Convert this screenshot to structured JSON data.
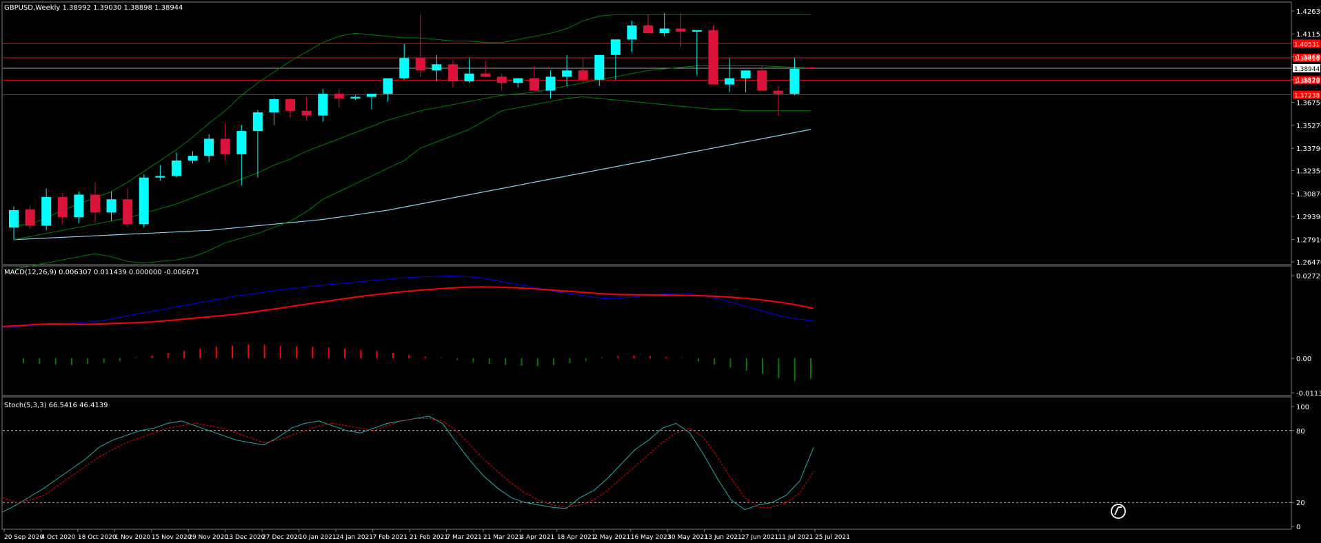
{
  "chart_data": {
    "type": "candlestick",
    "x_labels": [
      "20 Sep 2020",
      "4 Oct 2020",
      "18 Oct 2020",
      "1 Nov 2020",
      "15 Nov 2020",
      "29 Nov 2020",
      "13 Dec 2020",
      "27 Dec 2020",
      "10 Jan 2021",
      "24 Jan 2021",
      "7 Feb 2021",
      "21 Feb 2021",
      "7 Mar 2021",
      "21 Mar 2021",
      "4 Apr 2021",
      "18 Apr 2021",
      "2 May 2021",
      "16 May 2021",
      "30 May 2021",
      "13 Jun 2021",
      "27 Jun 2021",
      "11 Jul 2021",
      "25 Jul 2021"
    ],
    "colors": {
      "background": "#000000",
      "grid": "#808080",
      "bull": "#00FFFF",
      "bear": "#DC143C",
      "text": "#FFFFFF",
      "hline": "#FF0000",
      "bollinger": "#008000",
      "ma": "#87CEEB",
      "macd_line": "#0000FF",
      "macd_signal": "#FF0000",
      "hist_up": "#FF0000",
      "hist_down": "#008000",
      "stoch_k": "#20B2AA",
      "stoch_d": "#FF0000",
      "price_tag": "#FFFFFF"
    },
    "price_panel": {
      "title": "GBPUSD,Weekly  1.38992 1.39030 1.38898 1.38944",
      "y_ticks": [
        "1.42630",
        "1.41155",
        "1.39680",
        "1.38205",
        "1.36750",
        "1.35270",
        "1.33790",
        "1.32350",
        "1.30870",
        "1.29390",
        "1.27910",
        "1.26470"
      ],
      "y_tick_values": [
        1.4263,
        1.41155,
        1.3968,
        1.38205,
        1.3675,
        1.3527,
        1.3379,
        1.3235,
        1.3087,
        1.2939,
        1.2791,
        1.2647
      ],
      "ylim": [
        1.2647,
        1.4263
      ],
      "current_price": "1.38944",
      "current_value": 1.38944,
      "hlines": [
        {
          "label": "1.40531",
          "value": 1.40531
        },
        {
          "label": "1.39616",
          "value": 1.39616
        },
        {
          "label": "1.38178",
          "value": 1.38178
        },
        {
          "label": "1.37238",
          "value": 1.37238
        }
      ],
      "candles": [
        [
          1.2868,
          1.3005,
          1.279,
          1.298
        ],
        [
          1.2985,
          1.301,
          1.286,
          1.288
        ],
        [
          1.288,
          1.312,
          1.285,
          1.3065
        ],
        [
          1.3065,
          1.309,
          1.289,
          1.2935
        ],
        [
          1.2935,
          1.31,
          1.2895,
          1.308
        ],
        [
          1.308,
          1.316,
          1.29,
          1.2965
        ],
        [
          1.2965,
          1.31,
          1.291,
          1.305
        ],
        [
          1.305,
          1.312,
          1.287,
          1.289
        ],
        [
          1.289,
          1.321,
          1.287,
          1.319
        ],
        [
          1.319,
          1.327,
          1.317,
          1.32
        ],
        [
          1.32,
          1.335,
          1.319,
          1.33
        ],
        [
          1.33,
          1.336,
          1.328,
          1.333
        ],
        [
          1.333,
          1.347,
          1.329,
          1.344
        ],
        [
          1.344,
          1.354,
          1.33,
          1.334
        ],
        [
          1.334,
          1.353,
          1.314,
          1.349
        ],
        [
          1.349,
          1.3625,
          1.319,
          1.361
        ],
        [
          1.361,
          1.37,
          1.353,
          1.3695
        ],
        [
          1.3695,
          1.37,
          1.357,
          1.362
        ],
        [
          1.362,
          1.371,
          1.356,
          1.359
        ],
        [
          1.359,
          1.376,
          1.355,
          1.373
        ],
        [
          1.373,
          1.376,
          1.364,
          1.37
        ],
        [
          1.37,
          1.372,
          1.369,
          1.371
        ],
        [
          1.371,
          1.373,
          1.363,
          1.373
        ],
        [
          1.373,
          1.378,
          1.368,
          1.383
        ],
        [
          1.383,
          1.405,
          1.382,
          1.396
        ],
        [
          1.396,
          1.424,
          1.384,
          1.388
        ],
        [
          1.388,
          1.398,
          1.381,
          1.392
        ],
        [
          1.392,
          1.395,
          1.377,
          1.381
        ],
        [
          1.381,
          1.396,
          1.38,
          1.386
        ],
        [
          1.386,
          1.394,
          1.384,
          1.384
        ],
        [
          1.384,
          1.386,
          1.375,
          1.38
        ],
        [
          1.38,
          1.381,
          1.377,
          1.383
        ],
        [
          1.383,
          1.391,
          1.379,
          1.375
        ],
        [
          1.375,
          1.388,
          1.37,
          1.384
        ],
        [
          1.384,
          1.398,
          1.378,
          1.388
        ],
        [
          1.388,
          1.396,
          1.38,
          1.382
        ],
        [
          1.382,
          1.396,
          1.378,
          1.398
        ],
        [
          1.398,
          1.408,
          1.382,
          1.408
        ],
        [
          1.408,
          1.42,
          1.4,
          1.417
        ],
        [
          1.417,
          1.424,
          1.414,
          1.412
        ],
        [
          1.412,
          1.425,
          1.41,
          1.415
        ],
        [
          1.415,
          1.425,
          1.403,
          1.413
        ],
        [
          1.413,
          1.414,
          1.385,
          1.414
        ],
        [
          1.414,
          1.417,
          1.379,
          1.379
        ],
        [
          1.379,
          1.396,
          1.374,
          1.383
        ],
        [
          1.383,
          1.386,
          1.374,
          1.388
        ],
        [
          1.388,
          1.391,
          1.382,
          1.375
        ],
        [
          1.375,
          1.378,
          1.359,
          1.373
        ],
        [
          1.373,
          1.396,
          1.372,
          1.389
        ],
        [
          1.38992,
          1.3903,
          1.38898,
          1.38944
        ]
      ],
      "bollinger_upper": [
        1.288,
        1.289,
        1.293,
        1.298,
        1.302,
        1.306,
        1.31,
        1.316,
        1.323,
        1.33,
        1.337,
        1.345,
        1.354,
        1.362,
        1.372,
        1.38,
        1.387,
        1.394,
        1.4,
        1.406,
        1.41,
        1.412,
        1.411,
        1.41,
        1.409,
        1.409,
        1.408,
        1.407,
        1.407,
        1.406,
        1.406,
        1.408,
        1.41,
        1.412,
        1.415,
        1.42,
        1.423,
        1.424,
        1.424,
        1.424,
        1.424,
        1.424,
        1.424,
        1.424,
        1.424,
        1.424,
        1.424,
        1.424,
        1.424,
        1.424
      ],
      "bollinger_middle": [
        1.279,
        1.281,
        1.283,
        1.285,
        1.287,
        1.289,
        1.291,
        1.293,
        1.296,
        1.299,
        1.302,
        1.306,
        1.31,
        1.314,
        1.318,
        1.322,
        1.327,
        1.331,
        1.336,
        1.34,
        1.344,
        1.348,
        1.352,
        1.356,
        1.359,
        1.362,
        1.364,
        1.366,
        1.368,
        1.37,
        1.372,
        1.373,
        1.374,
        1.376,
        1.378,
        1.38,
        1.382,
        1.384,
        1.386,
        1.388,
        1.389,
        1.39,
        1.391,
        1.391,
        1.391,
        1.391,
        1.391,
        1.3905,
        1.39,
        1.3895
      ],
      "bollinger_lower": [
        1.26,
        1.262,
        1.264,
        1.266,
        1.268,
        1.27,
        1.268,
        1.265,
        1.264,
        1.265,
        1.266,
        1.268,
        1.272,
        1.277,
        1.28,
        1.283,
        1.287,
        1.291,
        1.297,
        1.305,
        1.31,
        1.315,
        1.32,
        1.325,
        1.33,
        1.338,
        1.342,
        1.346,
        1.35,
        1.356,
        1.362,
        1.364,
        1.366,
        1.368,
        1.37,
        1.371,
        1.37,
        1.369,
        1.368,
        1.367,
        1.366,
        1.365,
        1.364,
        1.363,
        1.363,
        1.362,
        1.362,
        1.362,
        1.362,
        1.362
      ],
      "ma": [
        1.279,
        1.2795,
        1.28,
        1.2805,
        1.281,
        1.2815,
        1.282,
        1.2825,
        1.283,
        1.2835,
        1.284,
        1.2845,
        1.285,
        1.286,
        1.287,
        1.288,
        1.289,
        1.29,
        1.291,
        1.292,
        1.2935,
        1.295,
        1.2965,
        1.298,
        1.3,
        1.302,
        1.304,
        1.306,
        1.308,
        1.31,
        1.312,
        1.314,
        1.316,
        1.318,
        1.32,
        1.322,
        1.324,
        1.326,
        1.328,
        1.33,
        1.332,
        1.334,
        1.336,
        1.338,
        1.34,
        1.342,
        1.344,
        1.346,
        1.348,
        1.35
      ]
    },
    "macd_panel": {
      "title": "MACD(12,26,9) 0.006307 0.011439 0.000000 -0.006671",
      "y_ticks": [
        "0.027285",
        "0.00",
        "-0.011331"
      ],
      "y_tick_values": [
        0.027285,
        0.0,
        -0.011331
      ],
      "ylim": [
        -0.011331,
        0.027285
      ],
      "main": [
        0.01,
        0.0105,
        0.011,
        0.0112,
        0.0115,
        0.0118,
        0.0125,
        0.0135,
        0.0145,
        0.0155,
        0.0165,
        0.0175,
        0.0185,
        0.0195,
        0.0205,
        0.0212,
        0.022,
        0.0228,
        0.0234,
        0.024,
        0.0245,
        0.025,
        0.0255,
        0.026,
        0.0265,
        0.0268,
        0.027,
        0.0272,
        0.027,
        0.0265,
        0.0255,
        0.0245,
        0.0235,
        0.0225,
        0.0215,
        0.0208,
        0.02,
        0.0198,
        0.0202,
        0.0208,
        0.0212,
        0.0215,
        0.021,
        0.02,
        0.0185,
        0.017,
        0.0155,
        0.014,
        0.013,
        0.0125
      ],
      "signal": [
        0.0105,
        0.0108,
        0.0112,
        0.0114,
        0.0113,
        0.0112,
        0.0114,
        0.0116,
        0.0118,
        0.012,
        0.0125,
        0.013,
        0.0135,
        0.014,
        0.0145,
        0.0152,
        0.016,
        0.0168,
        0.0176,
        0.0184,
        0.0192,
        0.02,
        0.0207,
        0.0213,
        0.0219,
        0.0224,
        0.0228,
        0.0232,
        0.0235,
        0.0236,
        0.0235,
        0.0233,
        0.023,
        0.0226,
        0.0222,
        0.0218,
        0.0214,
        0.0211,
        0.021,
        0.021,
        0.0209,
        0.0208,
        0.0207,
        0.0205,
        0.0202,
        0.0198,
        0.0192,
        0.0185,
        0.0176,
        0.0165
      ],
      "histogram": [
        -0.0015,
        -0.0018,
        -0.002,
        -0.0022,
        -0.0019,
        -0.0015,
        -0.0008,
        0.0002,
        0.001,
        0.0018,
        0.0025,
        0.0032,
        0.0039,
        0.0043,
        0.0046,
        0.0045,
        0.0042,
        0.004,
        0.0038,
        0.0035,
        0.0032,
        0.0028,
        0.0024,
        0.0018,
        0.0012,
        0.0006,
        0.0002,
        -0.0005,
        -0.0012,
        -0.0018,
        -0.0022,
        -0.0024,
        -0.0025,
        -0.0022,
        -0.0015,
        -0.0008,
        0.0003,
        0.0008,
        0.001,
        0.0008,
        0.0005,
        0.0002,
        -0.001,
        -0.002,
        -0.003,
        -0.004,
        -0.005,
        -0.0065,
        -0.0075,
        -0.0067
      ]
    },
    "stoch_panel": {
      "title": "Stoch(5,3,3) 66.5416 46.4139",
      "y_ticks": [
        "100",
        "80",
        "20",
        "0"
      ],
      "y_tick_values": [
        100,
        80,
        20,
        0
      ],
      "ylim": [
        0,
        100
      ],
      "levels": [
        80,
        20
      ],
      "k": [
        12,
        18,
        25,
        32,
        40,
        48,
        56,
        66,
        72,
        76,
        80,
        82,
        86,
        88,
        84,
        80,
        76,
        72,
        70,
        68,
        74,
        82,
        86,
        88,
        84,
        80,
        78,
        82,
        86,
        88,
        90,
        92,
        86,
        70,
        55,
        42,
        32,
        24,
        20,
        18,
        16,
        15,
        24,
        30,
        40,
        52,
        64,
        72,
        82,
        86,
        78,
        60,
        40,
        22,
        14,
        18,
        20,
        26,
        38,
        66
      ],
      "d": [
        24,
        20,
        22,
        26,
        34,
        42,
        50,
        58,
        64,
        70,
        74,
        78,
        82,
        84,
        86,
        84,
        82,
        78,
        74,
        70,
        72,
        76,
        80,
        84,
        86,
        84,
        82,
        80,
        84,
        88,
        90,
        90,
        88,
        80,
        68,
        56,
        46,
        36,
        28,
        22,
        18,
        16,
        18,
        22,
        30,
        40,
        50,
        60,
        70,
        78,
        82,
        74,
        58,
        40,
        24,
        16,
        16,
        20,
        28,
        46
      ]
    }
  }
}
